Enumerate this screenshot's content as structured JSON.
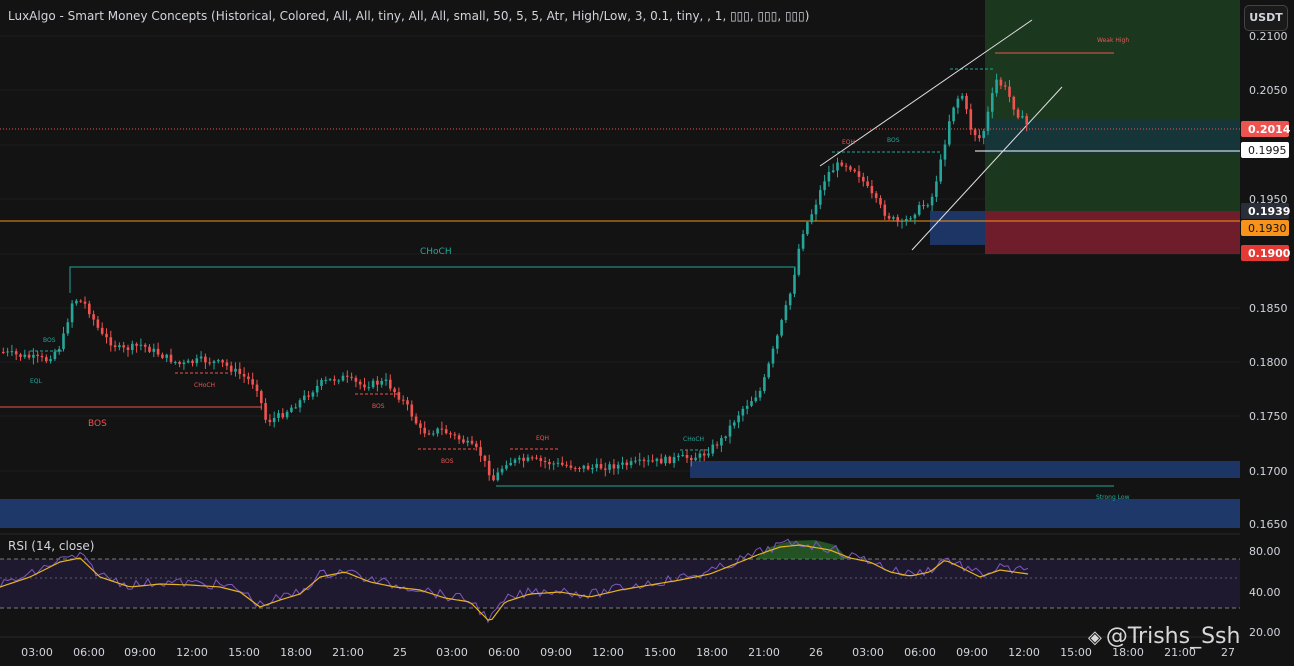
{
  "indicator_title": "LuxAlgo - Smart Money Concepts (Historical, Colored, All, All, tiny, All, All, small, 50, 5, 5, Atr, High/Low, 3, 0.1, tiny, , 1, ▯▯▯, ▯▯▯, ▯▯▯)",
  "currency_button": "USDT",
  "price_axis": {
    "ticks": [
      "0.2100",
      "0.2050",
      "0.1950",
      "0.1850",
      "0.1800",
      "0.1750",
      "0.1700",
      "0.1650"
    ],
    "badges": {
      "last_price": "0.2014",
      "white_level": "0.1995",
      "level_1939": "0.1939",
      "orange_level": "0.1930",
      "red_level": "0.1900"
    }
  },
  "time_axis": [
    "03:00",
    "06:00",
    "09:00",
    "12:00",
    "15:00",
    "18:00",
    "21:00",
    "25",
    "03:00",
    "06:00",
    "09:00",
    "12:00",
    "15:00",
    "18:00",
    "21:00",
    "26",
    "03:00",
    "06:00",
    "09:00",
    "12:00",
    "15:00",
    "18:00",
    "21:00",
    "27"
  ],
  "annotations": {
    "choch_main": "CHoCH",
    "bos_left": "BOS",
    "bos_small_1": "BOS",
    "eql": "EQL",
    "choch_small": "CHoCH",
    "bos_small_2": "BOS",
    "bos_small_3": "BOS",
    "eqh_1": "EQH",
    "choch_green": "CHoCH",
    "eqh_2": "EQH",
    "bos_green": "BOS",
    "weak_high": "Weak High",
    "strong_low": "Strong Low"
  },
  "rsi": {
    "title": "RSI (14, close)",
    "ticks": [
      "80.00",
      "40.00",
      "20.00"
    ]
  },
  "colors": {
    "background": "#131313",
    "bull": "#26a69a",
    "bear": "#ef5350",
    "orange": "#f7931a",
    "rsi_line": "#7e57c2",
    "rsi_ma": "#e6b422",
    "zone_blue": "#1e3a6e",
    "zone_green": "#1b3a20",
    "zone_red": "#7a1f2e"
  },
  "watermark": "@Trishs_Ssh"
}
